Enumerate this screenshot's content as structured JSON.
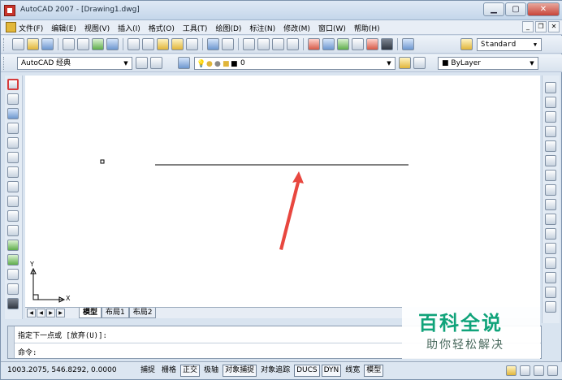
{
  "window": {
    "title": "AutoCAD 2007 - [Drawing1.dwg]",
    "controls": [
      "▁",
      "▢",
      "✕"
    ]
  },
  "menu": {
    "items": [
      "文件(F)",
      "编辑(E)",
      "视图(V)",
      "插入(I)",
      "格式(O)",
      "工具(T)",
      "绘图(D)",
      "标注(N)",
      "修改(M)",
      "窗口(W)",
      "帮助(H)"
    ],
    "doc_controls": [
      "_",
      "❐",
      "✕"
    ]
  },
  "toolbar1": {
    "text_style": "Standard"
  },
  "toolbar2": {
    "workspace": "AutoCAD 经典",
    "layer": "0",
    "color": "ByLayer"
  },
  "canvas": {
    "ucs_x": "X",
    "ucs_y": "Y"
  },
  "layout_tabs": [
    "模型",
    "布局1",
    "布局2"
  ],
  "command": {
    "prompt_line": "指定下一点或 [放弃(U)]:",
    "input_line": "命令:"
  },
  "status": {
    "coordinates": "1003.2075, 546.8292, 0.0000",
    "buttons": [
      "捕捉",
      "栅格",
      "正交",
      "极轴",
      "对象捕捉",
      "对象追踪",
      "DUCS",
      "DYN",
      "线宽",
      "模型"
    ],
    "active": [
      "正交",
      "对象捕捉",
      "DUCS",
      "DYN",
      "模型"
    ]
  },
  "watermark": {
    "logo": "百科全说",
    "subtitle": "助你轻松解决"
  },
  "colors": {
    "highlight": "#d63b3b",
    "arrow": "#e8473f",
    "watermark_green": "#10a37a"
  }
}
